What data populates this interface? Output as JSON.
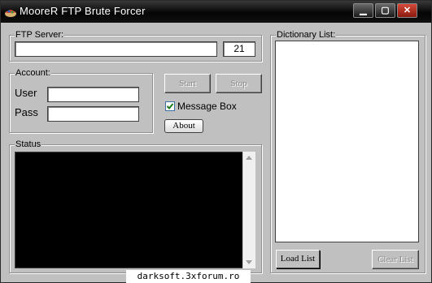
{
  "window": {
    "title": "MooreR FTP Brute Forcer",
    "controls": {
      "minimize": "▁",
      "maximize": "▢",
      "close": "✕"
    }
  },
  "ftp_server": {
    "legend": "FTP Server:",
    "host_value": "",
    "port_value": "21"
  },
  "account": {
    "legend": "Account:",
    "user_label": "User",
    "user_value": "",
    "pass_label": "Pass",
    "pass_value": ""
  },
  "controls": {
    "start_label": "Start",
    "stop_label": "Stop",
    "message_box_label": "Message Box",
    "message_box_checked": true,
    "about_label": "About"
  },
  "status": {
    "legend": "Status"
  },
  "dictionary": {
    "legend": "Dictionary List:",
    "load_label": "Load List",
    "clear_label": "Clear List"
  },
  "watermark": "darksoft.3xforum.ro",
  "colors": {
    "face": "#c0c0c0",
    "status_bg": "#000000",
    "titlebar": "#0a0a0a"
  }
}
